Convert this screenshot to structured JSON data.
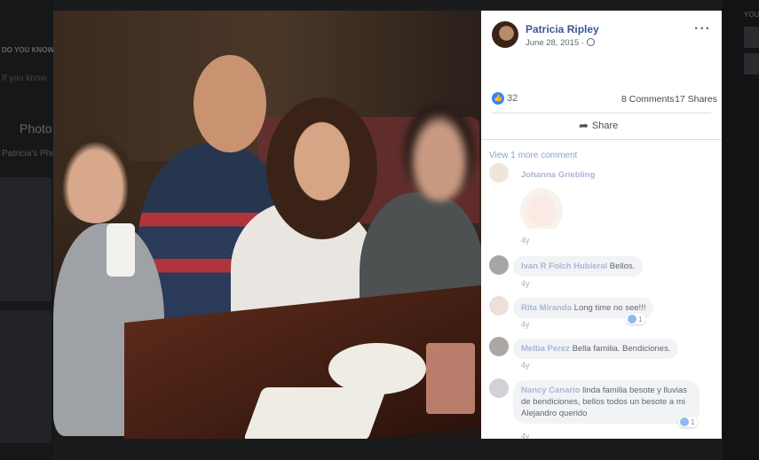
{
  "background_page": {
    "left_heading": "DO YOU KNOW",
    "left_subtext": "If you know",
    "photos_heading": "Photo",
    "photos_sub": "Patricia's Phot",
    "right_text": "YOU"
  },
  "post": {
    "author": "Patricia Ripley",
    "date": "June 28, 2015 ·",
    "more_label": "···",
    "reactions_count": "32",
    "comments_count": "8 Comments",
    "shares_count": "17 Shares",
    "share_label": "Share"
  },
  "comments": {
    "view_more": "View 1 more comment",
    "items": [
      {
        "name": "Johanna Griebling",
        "text": "",
        "time": "4y"
      },
      {
        "name": "Ivan R Folch Hubieral",
        "text": "Bellos.",
        "time": "4y"
      },
      {
        "name": "Rita Miranda",
        "text": "Long time no see!!!",
        "time": "4y",
        "reactions": "1"
      },
      {
        "name": "Melba Perez",
        "text": "Bella familia. Bendiciones.",
        "time": "4y"
      },
      {
        "name": "Nancy Canario",
        "text": "linda familia besote y lluvias de bendiciones, bellos todos un besote a mi Alejandro querido",
        "time": "4y",
        "reactions": "1"
      }
    ]
  },
  "colors": {
    "link": "#385898",
    "like_blue": "#2d86ff",
    "panel_bg": "#ffffff",
    "overlay_bg": "#0b0b0b"
  },
  "icons": [
    "globe-icon",
    "more-options-icon",
    "like-icon",
    "share-icon"
  ]
}
